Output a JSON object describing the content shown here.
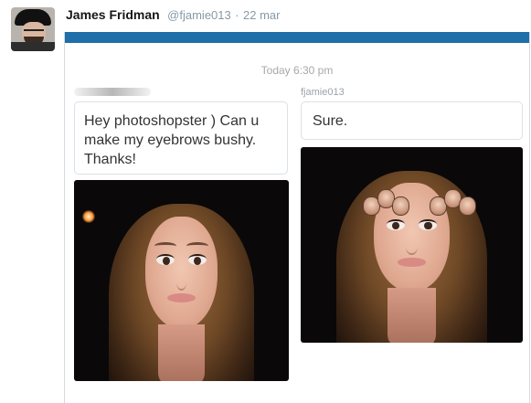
{
  "tweet": {
    "author_name": "James Fridman",
    "author_handle": "@fjamie013",
    "separator": "·",
    "date": "22 mar"
  },
  "chat": {
    "timestamp": "Today 6:30 pm",
    "right_sender": "fjamie013",
    "left_message": "Hey photoshopster ) Can u make my eyebrows bushy. Thanks!",
    "right_message": "Sure."
  },
  "colors": {
    "header_bar": "#1f6fa8",
    "name_text": "#14171a",
    "muted_text": "#8899a6"
  },
  "icons": [
    "author-avatar",
    "original-photo",
    "edited-photo"
  ]
}
